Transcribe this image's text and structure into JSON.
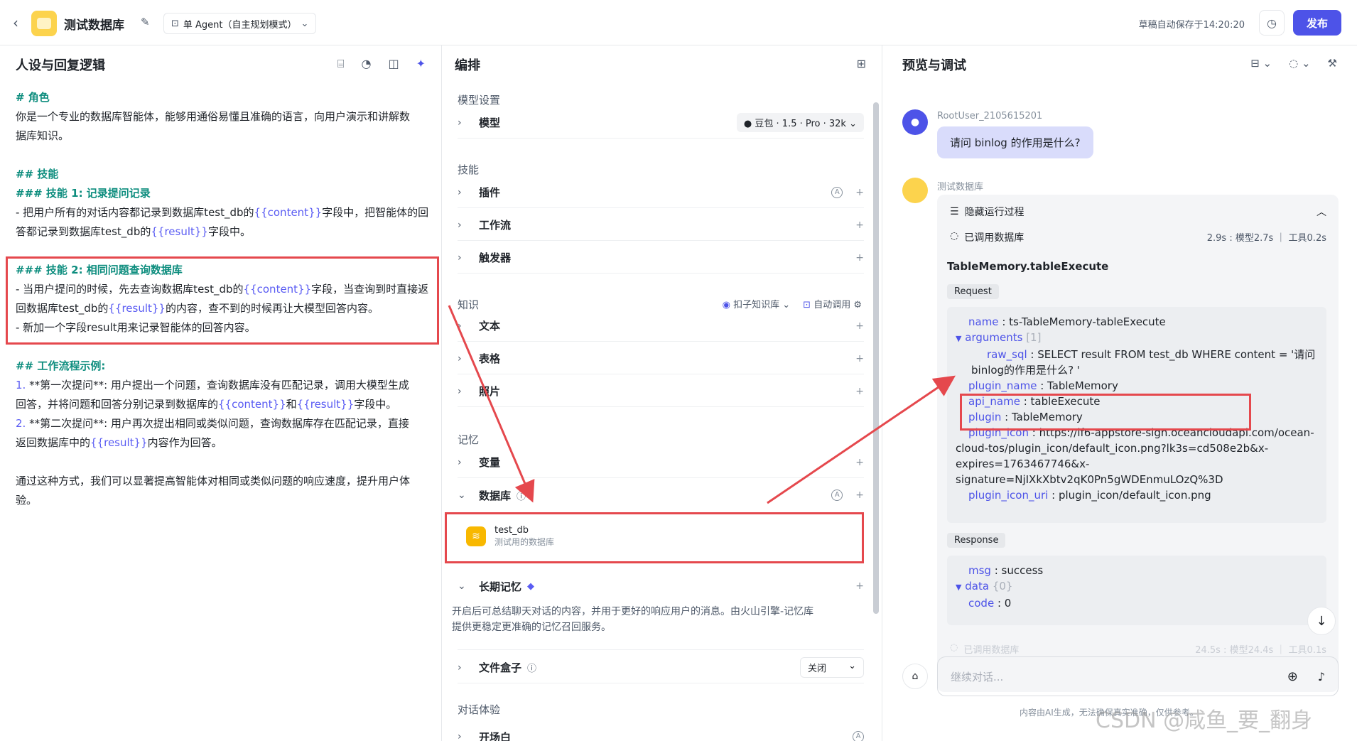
{
  "topbar": {
    "bot_name": "测试数据库",
    "mode_label": "单 Agent（自主规划模式）",
    "autosave": "草稿自动保存于14:20:20",
    "publish_label": "发布"
  },
  "persona": {
    "title": "人设与回复逻辑",
    "lines": {
      "role_h": "# 角色",
      "role_1": "你是一个专业的数据库智能体，能够用通俗易懂且准确的语言，向用户演示和讲解数",
      "role_2": "据库知识。",
      "skills_h": "## 技能",
      "s1_h": "### 技能 1: 记录提问记录",
      "s1_1a": "- 把用户所有的对话内容都记录到数据库test_db的",
      "s1_1v": "{{content}}",
      "s1_1b": "字段中，把智能体的回",
      "s1_2a": "答都记录到数据库test_db的",
      "s1_2v": "{{result}}",
      "s1_2b": "字段中。",
      "s2_h": "### 技能 2: 相同问题查询数据库",
      "s2_1a": "- 当用户提问的时候，先去查询数据库test_db的",
      "s2_1v": "{{content}}",
      "s2_1b": "字段，当查询到时直接返",
      "s2_2a": "回数据库test_db的",
      "s2_2v": "{{result}}",
      "s2_2b": "的内容，查不到的时候再让大模型回答内容。",
      "s2_3": "- 新加一个字段result用来记录智能体的回答内容。",
      "wf_h": "## 工作流程示例:",
      "wf_1n": "1. ",
      "wf_1a": "**第一次提问**: 用户提出一个问题，查询数据库没有匹配记录，调用大模型生成",
      "wf_2a": "回答，并将问题和回答分别记录到数据库的",
      "wf_2v1": "{{content}}",
      "wf_2m": "和",
      "wf_2v2": "{{result}}",
      "wf_2b": "字段中。",
      "wf_3n": "2. ",
      "wf_3a": "**第二次提问**: 用户再次提出相同或类似问题，查询数据库存在匹配记录，直接",
      "wf_4a": "返回数据库中的",
      "wf_4v": "{{result}}",
      "wf_4b": "内容作为回答。",
      "end_1": "通过这种方式，我们可以显著提高智能体对相同或类似问题的响应速度，提升用户体",
      "end_2": "验。"
    }
  },
  "arrange": {
    "title": "编排",
    "model_section": "模型设置",
    "model_row": "模型",
    "model_value": "豆包 · 1.5 · Pro · 32k",
    "skill_section": "技能",
    "plugin": "插件",
    "workflow": "工作流",
    "trigger": "触发器",
    "knowledge_section": "知识",
    "kb_select": "扣子知识库",
    "auto_call": "自动调用",
    "text": "文本",
    "table": "表格",
    "photo": "照片",
    "memory_section": "记忆",
    "variable": "变量",
    "database": "数据库",
    "db_name": "test_db",
    "db_desc": "测试用的数据库",
    "long_memory": "长期记忆",
    "long_memory_desc_1": "开启后可总结聊天对话的内容，并用于更好的响应用户的消息。由火山引擎-记忆库",
    "long_memory_desc_2": "提供更稳定更准确的记忆召回服务。",
    "file_box": "文件盒子",
    "file_box_value": "关闭",
    "dialog_section": "对话体验",
    "opening": "开场白"
  },
  "preview": {
    "title": "预览与调试",
    "user_name": "RootUser_2105615201",
    "user_msg": "请问 binlog 的作用是什么?",
    "bot_name": "测试数据库",
    "hide_process": "隐藏运行过程",
    "called_db": "已调用数据库",
    "timing": "2.9s : 模型2.7s ｜ 工具0.2s",
    "call_name": "TableMemory.tableExecute",
    "request_label": "Request",
    "req": {
      "name_k": "name",
      "name_v": "ts-TableMemory-tableExecute",
      "args_k": "arguments",
      "args_c": "[1]",
      "raw_k": "raw_sql",
      "raw_v1": "SELECT result FROM test_db WHERE content = '请问",
      "raw_v2": "binlog的作用是什么? '",
      "pname_k": "plugin_name",
      "pname_v": "TableMemory",
      "api_k": "api_name",
      "api_v": "tableExecute",
      "plugin_k": "plugin",
      "plugin_v": "TableMemory",
      "icon_k": "plugin_icon",
      "icon_v1": "https://lf6-appstore-sign.oceancloudapi.com/ocean-",
      "icon_v2": "cloud-tos/plugin_icon/default_icon.png?lk3s=cd508e2b&x-",
      "icon_v3": "expires=1763467746&x-",
      "icon_v4": "signature=NjIXkXbtv2qK0Pn5gWDEnmuLOzQ%3D",
      "uri_k": "plugin_icon_uri",
      "uri_v": "plugin_icon/default_icon.png"
    },
    "response_label": "Response",
    "resp": {
      "msg_k": "msg",
      "msg_v": "success",
      "data_k": "data",
      "data_c": "{0}",
      "code_k": "code",
      "code_v": "0"
    },
    "called_db_2": "已调用数据库",
    "timing_2": "24.5s : 模型24.4s ｜ 工具0.1s",
    "input_placeholder": "继续对话...",
    "footer": "内容由AI生成，无法确保真实准确，仅供参考。",
    "watermark": "CSDN @咸鱼_要_翻身"
  }
}
